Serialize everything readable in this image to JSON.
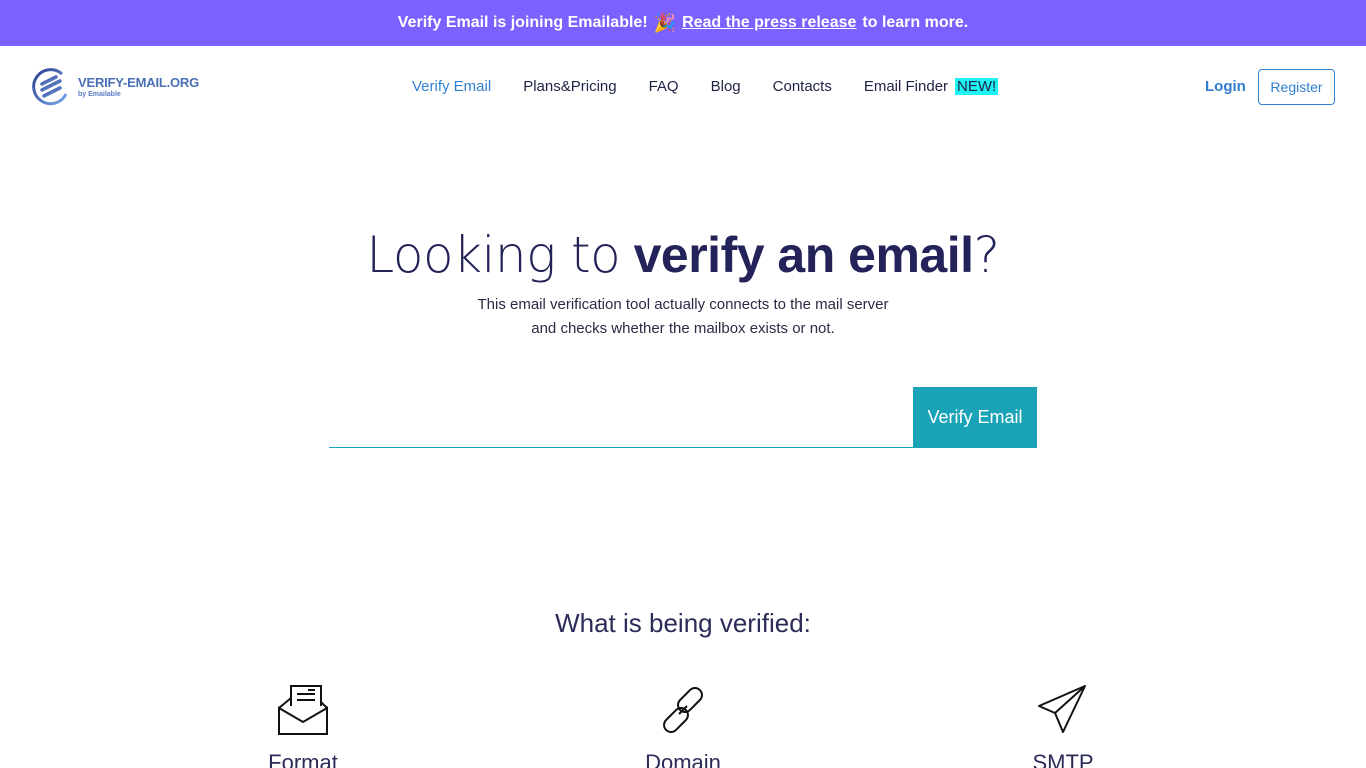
{
  "banner": {
    "text_before": "Verify Email is joining Emailable!",
    "emoji": "🎉",
    "link_text": "Read the press release",
    "text_after": "to learn more.",
    "background": "#7b61ff"
  },
  "logo": {
    "title": "VERIFY-EMAIL.ORG",
    "subtitle": "by Emailable"
  },
  "nav": {
    "items": [
      {
        "label": "Verify Email",
        "active": true
      },
      {
        "label": "Plans&Pricing"
      },
      {
        "label": "FAQ"
      },
      {
        "label": "Blog"
      },
      {
        "label": "Contacts"
      },
      {
        "label": "Email Finder",
        "badge": "NEW!"
      }
    ],
    "login": "Login",
    "register": "Register"
  },
  "hero": {
    "title_light": "Looking to",
    "title_bold": "verify an email",
    "title_end": "?",
    "subtitle_line1": "This email verification tool actually connects to the mail server",
    "subtitle_line2": "and checks whether the mailbox exists or not."
  },
  "search": {
    "value": "",
    "placeholder": "",
    "button_label": "Verify Email",
    "accent": "#1aa3b7"
  },
  "features": {
    "title": "What is being verified:",
    "items": [
      {
        "label": "Format",
        "icon": "envelope-open-icon"
      },
      {
        "label": "Domain",
        "icon": "link-icon"
      },
      {
        "label": "SMTP",
        "icon": "paper-plane-icon"
      }
    ]
  }
}
